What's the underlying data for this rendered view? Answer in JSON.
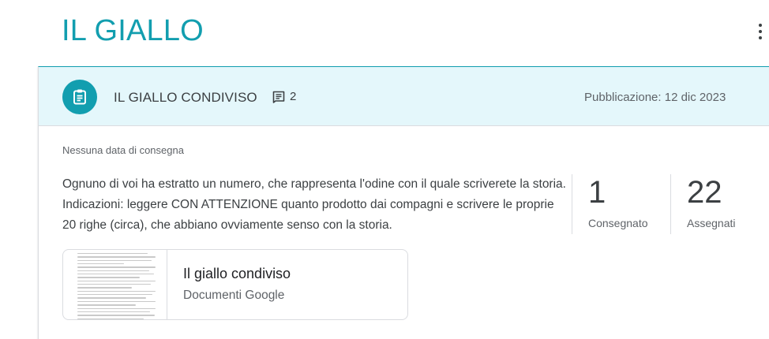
{
  "page": {
    "title": "IL GIALLO",
    "more_icon": "more-vert-icon"
  },
  "assignment": {
    "icon": "assignment-icon",
    "title": "IL GIALLO CONDIVISO",
    "comment_icon": "comment-icon",
    "comment_count": "2",
    "published": "Pubblicazione: 12 dic 2023",
    "due": "Nessuna data di consegna",
    "description": "Ognuno di voi ha estratto un numero, che rappresenta l'odine con il quale scriverete la storia. Indicazioni: leggere CON ATTENZIONE quanto prodotto dai compagni e scrivere le proprie 20 righe (circa), che abbiano ovviamente senso con la storia."
  },
  "stats": [
    {
      "value": "1",
      "label": "Consegnato"
    },
    {
      "value": "22",
      "label": "Assegnati"
    }
  ],
  "attachment": {
    "title": "Il giallo condiviso",
    "type": "Documenti Google"
  },
  "colors": {
    "accent": "#129eaf",
    "header_bg": "#e4f7fb"
  }
}
